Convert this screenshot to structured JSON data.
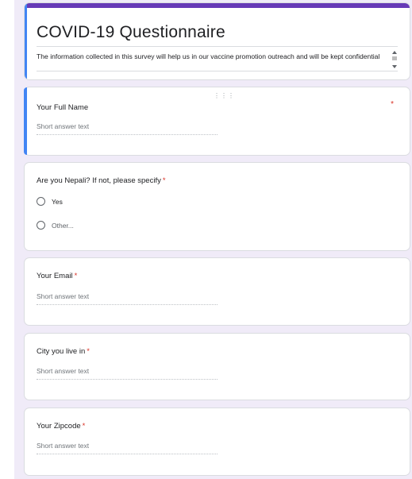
{
  "form": {
    "title": "COVID-19 Questionnaire",
    "description": "The information collected in this survey will help us in our vaccine promotion outreach and will be kept confidential"
  },
  "questions": [
    {
      "label": "Your Full Name",
      "required_mark": "*",
      "placeholder": "Short answer text"
    },
    {
      "label": "Are you Nepali? If not, please specify",
      "required_mark": "*",
      "options": [
        "Yes",
        "Other..."
      ]
    },
    {
      "label": "Your Email",
      "required_mark": "*",
      "placeholder": "Short answer text"
    },
    {
      "label": "City you live in",
      "required_mark": "*",
      "placeholder": "Short answer text"
    },
    {
      "label": "Your Zipcode",
      "required_mark": "*",
      "placeholder": "Short answer text"
    }
  ],
  "icons": {
    "drag_handle": "drag-handle-icon",
    "radio": "radio-button-icon"
  },
  "colors": {
    "theme": "#673ab7",
    "selected_accent": "#4285f4",
    "required": "#d93025",
    "background": "#f0ebf8"
  }
}
